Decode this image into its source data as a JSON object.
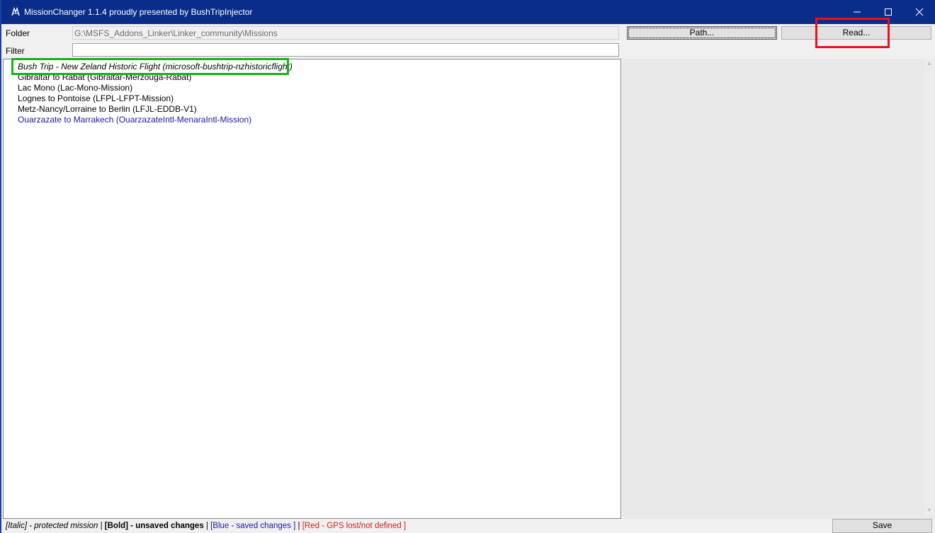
{
  "window": {
    "title": "MissionChanger 1.1.4 proudly presented by BushTripInjector",
    "minimize": "—",
    "maximize": "☐",
    "close": "✕"
  },
  "form": {
    "folder_label": "Folder",
    "folder_value": "G:\\MSFS_Addons_Linker\\Linker_community\\Missions",
    "filter_label": "Filter",
    "filter_value": ""
  },
  "buttons": {
    "path": "Path...",
    "read": "Read...",
    "save": "Save"
  },
  "missions": [
    "Bush Trip - New Zeland Historic Flight (microsoft-bushtrip-nzhistoricflight)",
    "Gibraltar to Rabat (Gibraltar-Merzouga-Rabat)",
    "Lac Mono (Lac-Mono-Mission)",
    "Lognes to Pontoise (LFPL-LFPT-Mission)",
    "Metz-Nancy/Lorraine to Berlin (LFJL-EDDB-V1)",
    "Ouarzazate to Marrakech (OuarzazateIntl-MenaraIntl-Mission)"
  ],
  "legend": {
    "italic": "[Italic] - protected mission",
    "sep1": " | ",
    "bold": "[Bold] - unsaved changes",
    "sep2": " | ",
    "blue": "[Blue - saved changes ]",
    "sep3": " | ",
    "red": "[Red - GPS lost/not defined ]"
  },
  "colors": {
    "titlebar": "#0a2d8a",
    "highlight_red": "#e8121c",
    "highlight_green": "#17b11a",
    "saved_blue": "#1a1aa6",
    "gps_red": "#d42020"
  },
  "icons": {
    "app": "app-icon",
    "scroll_up": "scroll-up-icon",
    "scroll_down": "scroll-down-icon"
  }
}
